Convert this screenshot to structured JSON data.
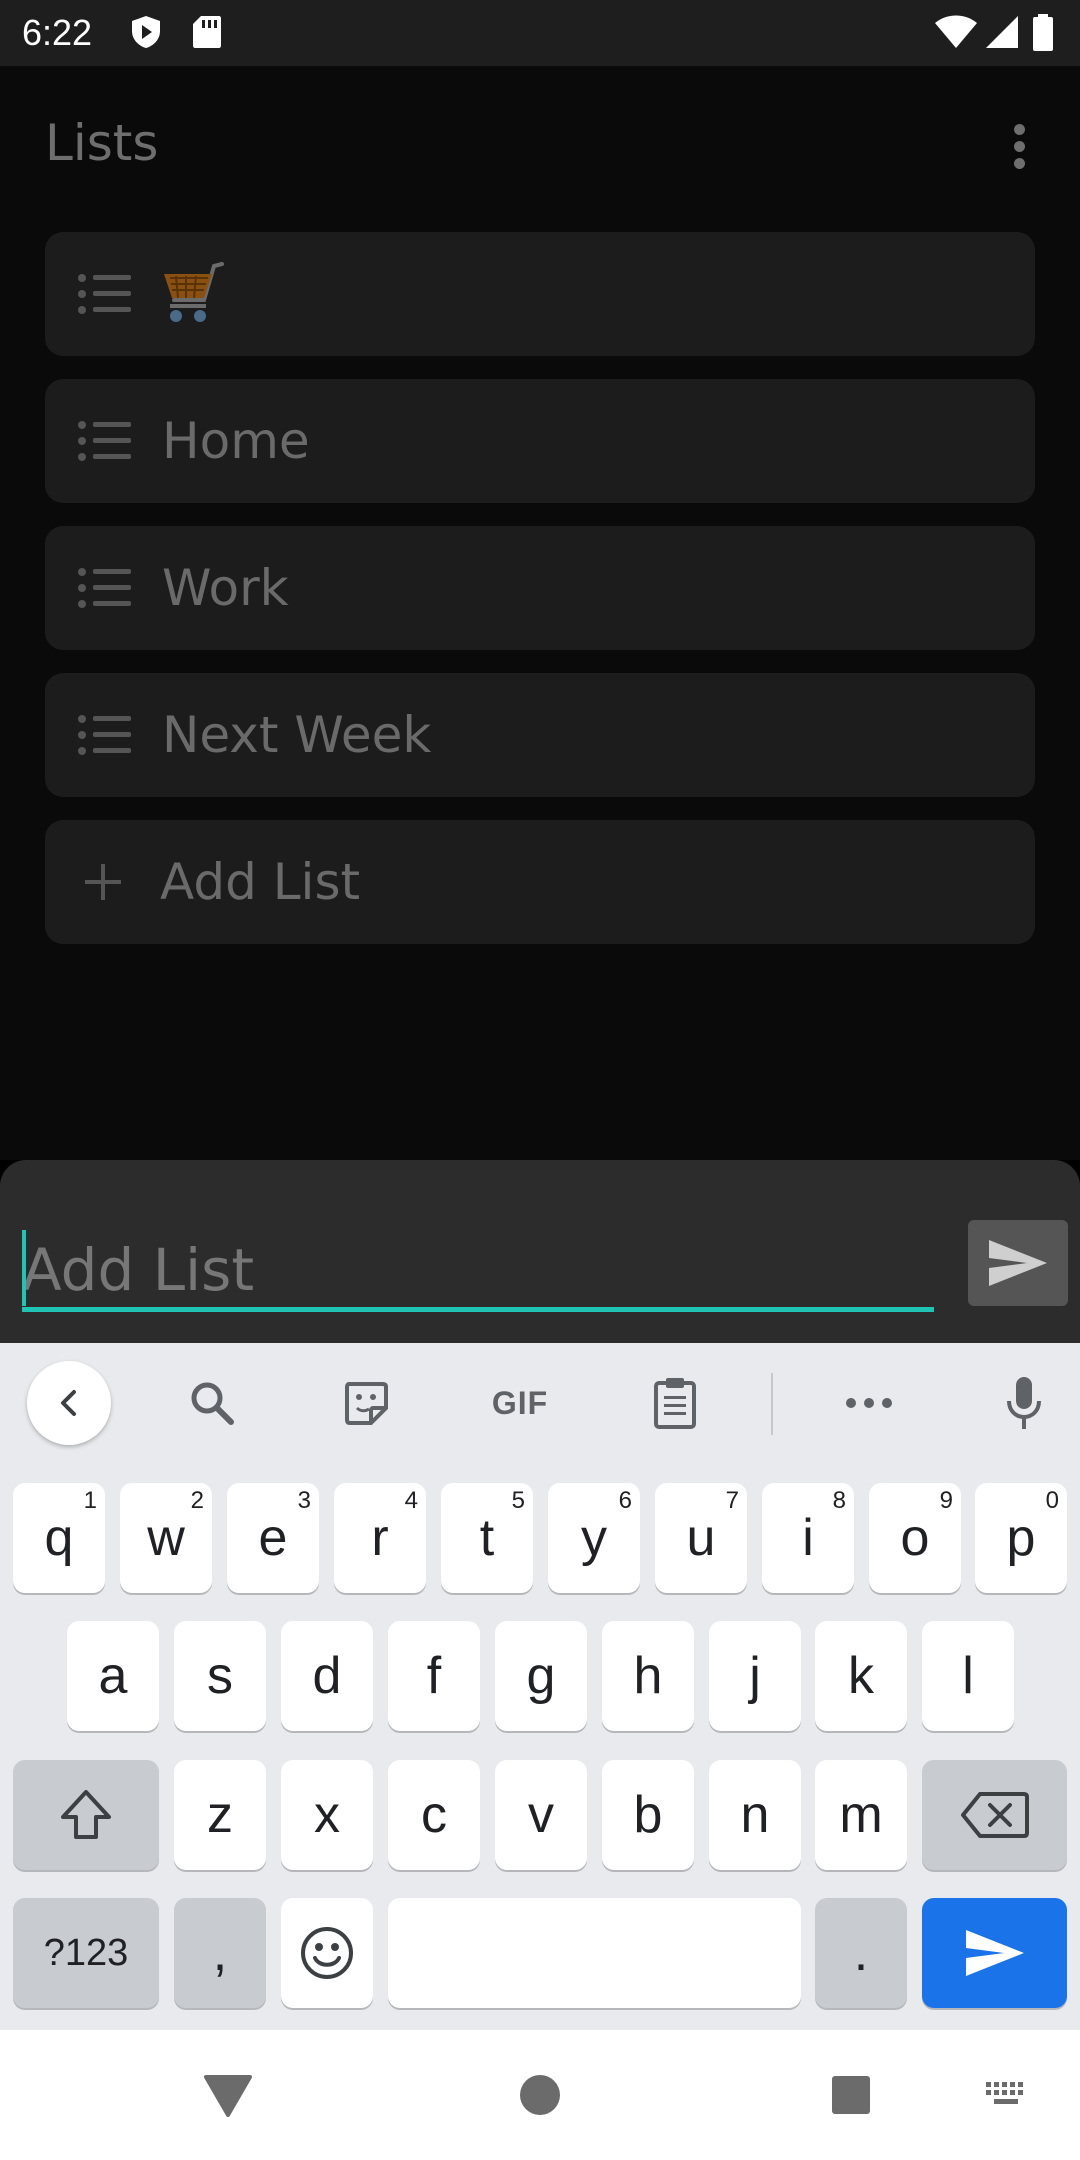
{
  "status_bar": {
    "time": "6:22"
  },
  "app": {
    "title": "Lists",
    "lists": [
      {
        "label": "",
        "icon": "shopping-cart-emoji"
      },
      {
        "label": "Home"
      },
      {
        "label": "Work"
      },
      {
        "label": "Next Week"
      }
    ],
    "add_list_label": "Add List"
  },
  "input_sheet": {
    "placeholder": "Add List",
    "value": ""
  },
  "keyboard": {
    "row1": [
      {
        "key": "q",
        "hint": "1"
      },
      {
        "key": "w",
        "hint": "2"
      },
      {
        "key": "e",
        "hint": "3"
      },
      {
        "key": "r",
        "hint": "4"
      },
      {
        "key": "t",
        "hint": "5"
      },
      {
        "key": "y",
        "hint": "6"
      },
      {
        "key": "u",
        "hint": "7"
      },
      {
        "key": "i",
        "hint": "8"
      },
      {
        "key": "o",
        "hint": "9"
      },
      {
        "key": "p",
        "hint": "0"
      }
    ],
    "row2": [
      "a",
      "s",
      "d",
      "f",
      "g",
      "h",
      "j",
      "k",
      "l"
    ],
    "row3": [
      "z",
      "x",
      "c",
      "v",
      "b",
      "n",
      "m"
    ],
    "symbols_label": "?123",
    "comma": ",",
    "period": ".",
    "toolbar_gif": "GIF"
  },
  "colors": {
    "accent": "#1fc4b5",
    "keyboard_action": "#1a73e8"
  }
}
